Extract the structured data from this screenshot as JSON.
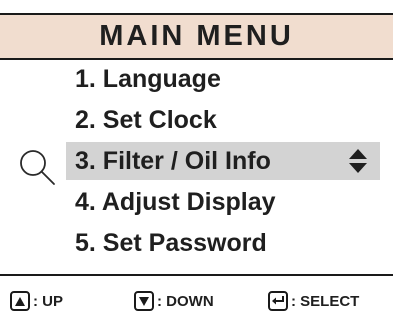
{
  "header": {
    "title": "MAIN MENU"
  },
  "menu": {
    "items": [
      {
        "label": "1. Language"
      },
      {
        "label": "2. Set Clock"
      },
      {
        "label": "3. Filter / Oil Info",
        "selected": true
      },
      {
        "label": "4. Adjust Display"
      },
      {
        "label": "5. Set Password"
      }
    ],
    "selection_icon": "magnifier-icon",
    "scroll_indicator_icon": "up-down-triangles-icon"
  },
  "footer": {
    "up": {
      "icon": "up-triangle-icon",
      "label": ": UP"
    },
    "down": {
      "icon": "down-triangle-icon",
      "label": ": DOWN"
    },
    "select": {
      "icon": "enter-arrow-icon",
      "label": ": SELECT"
    }
  },
  "colors": {
    "header_background": "#f1ddcf",
    "highlight": "#d3d3d3",
    "text": "#1f1f1f",
    "border": "#1a1a1a"
  }
}
